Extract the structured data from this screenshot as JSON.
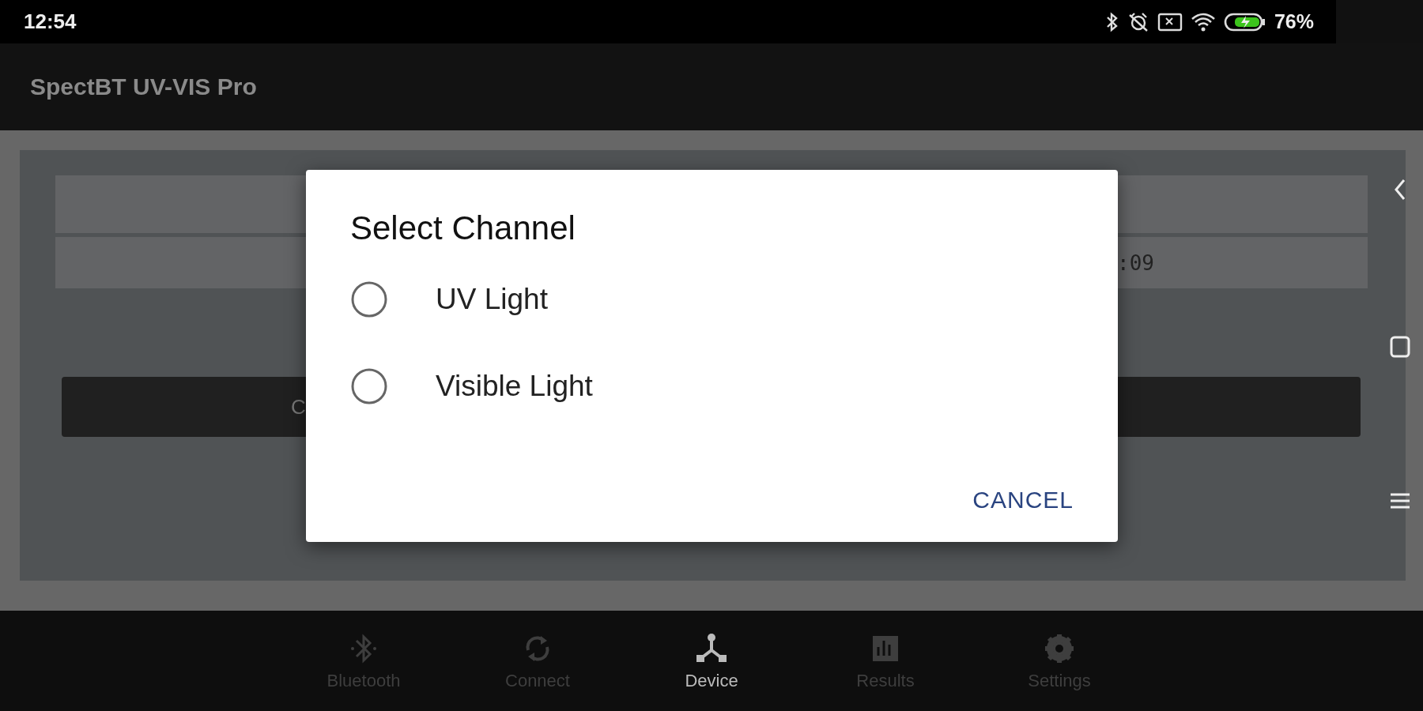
{
  "status_bar": {
    "time": "12:54",
    "battery_text": "76%"
  },
  "app_bar": {
    "title": "SpectBT UV-VIS Pro"
  },
  "card": {
    "row_2_text": ":09",
    "button_text": "C"
  },
  "dialog": {
    "title": "Select Channel",
    "options": [
      {
        "label": "UV Light",
        "selected": false
      },
      {
        "label": "Visible Light",
        "selected": false
      }
    ],
    "cancel": "CANCEL"
  },
  "bottom_nav": [
    {
      "label": "Bluetooth",
      "selected": false
    },
    {
      "label": "Connect",
      "selected": false
    },
    {
      "label": "Device",
      "selected": true
    },
    {
      "label": "Results",
      "selected": false
    },
    {
      "label": "Settings",
      "selected": false
    }
  ]
}
